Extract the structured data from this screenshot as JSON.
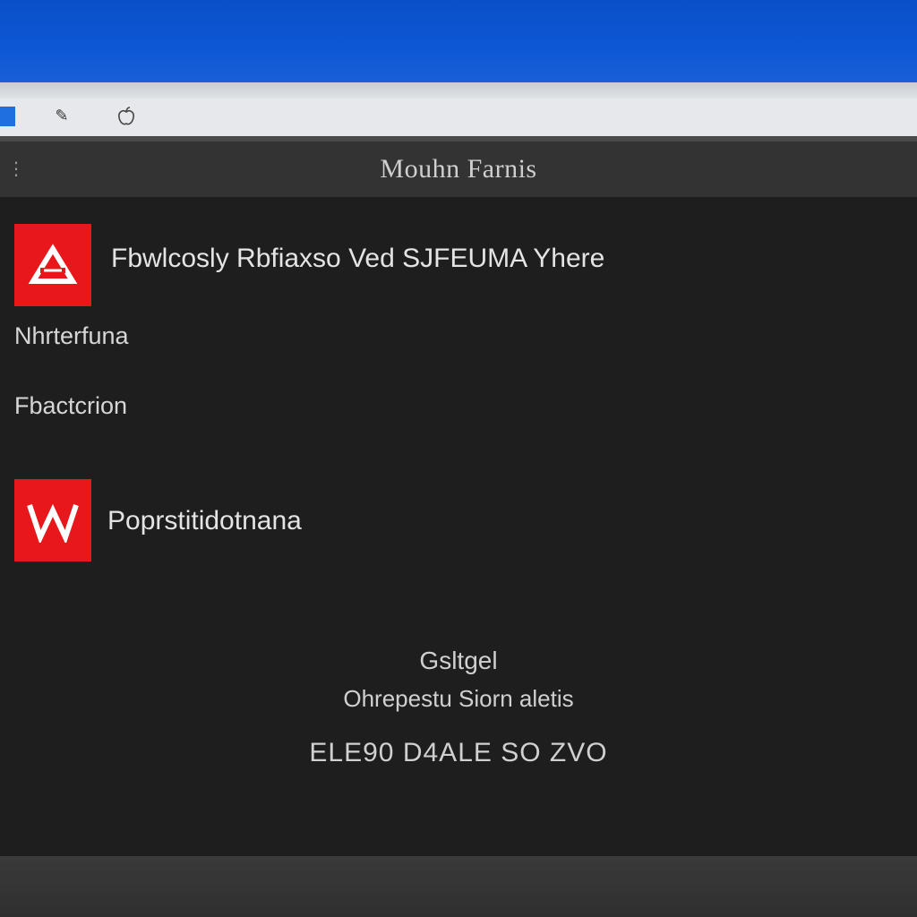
{
  "window": {
    "title": "Mouhn Farnis"
  },
  "toolbar": {
    "icons": [
      "edit-icon",
      "apple-icon"
    ]
  },
  "items": [
    {
      "icon_letter": "A",
      "icon_name": "triangle-logo-icon",
      "label": "Fbwlcosly Rbfiaxso Ved  SJFEUMA Yhere"
    },
    {
      "label": "Nhrterfuna"
    },
    {
      "label": "Fbactcrion"
    },
    {
      "icon_letter": "W",
      "icon_name": "w-logo-icon",
      "label": "Poprstitidotnana"
    }
  ],
  "footer": {
    "line1": "Gsltgel",
    "line2": "Ohrepestu Siorn aletis",
    "line3": "ELE90 D4ALE SO ZVO"
  },
  "colors": {
    "accent_red": "#e8171b",
    "desktop_blue": "#0d57d6",
    "panel_bg": "#1e1e1e"
  }
}
